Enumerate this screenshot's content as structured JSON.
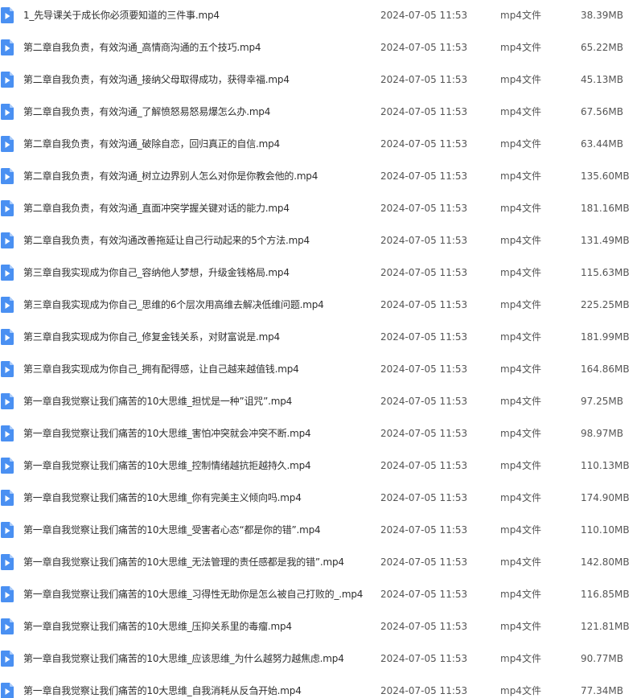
{
  "colors": {
    "icon_fill": "#4a90f2",
    "icon_fold": "#a9cbfa",
    "icon_glyph": "#ffffff",
    "text_primary": "#2e2e2e",
    "text_secondary": "#555555"
  },
  "icon": "video-file-icon",
  "files": [
    {
      "name": "1_先导课关于成长你必须要知道的三件事.mp4",
      "date": "2024-07-05 11:53",
      "type": "mp4文件",
      "size": "38.39MB"
    },
    {
      "name": "第二章自我负责，有效沟通_高情商沟通的五个技巧.mp4",
      "date": "2024-07-05 11:53",
      "type": "mp4文件",
      "size": "65.22MB"
    },
    {
      "name": "第二章自我负责，有效沟通_接纳父母取得成功，获得幸福.mp4",
      "date": "2024-07-05 11:53",
      "type": "mp4文件",
      "size": "45.13MB"
    },
    {
      "name": "第二章自我负责，有效沟通_了解愤怒易怒易爆怎么办.mp4",
      "date": "2024-07-05 11:53",
      "type": "mp4文件",
      "size": "67.56MB"
    },
    {
      "name": "第二章自我负责，有效沟通_破除自恋，回归真正的自信.mp4",
      "date": "2024-07-05 11:53",
      "type": "mp4文件",
      "size": "63.44MB"
    },
    {
      "name": "第二章自我负责，有效沟通_树立边界别人怎么对你是你教会他的.mp4",
      "date": "2024-07-05 11:53",
      "type": "mp4文件",
      "size": "135.60MB"
    },
    {
      "name": "第二章自我负责，有效沟通_直面冲突学握关键对话的能力.mp4",
      "date": "2024-07-05 11:53",
      "type": "mp4文件",
      "size": "181.16MB"
    },
    {
      "name": "第二章自我负责，有效沟通改善拖延让自己行动起来的5个方法.mp4",
      "date": "2024-07-05 11:53",
      "type": "mp4文件",
      "size": "131.49MB"
    },
    {
      "name": "第三章自我实现成为你自己_容纳他人梦想，升级金钱格局.mp4",
      "date": "2024-07-05 11:53",
      "type": "mp4文件",
      "size": "115.63MB"
    },
    {
      "name": "第三章自我实现成为你自己_思维的6个层次用高维去解决低维问题.mp4",
      "date": "2024-07-05 11:53",
      "type": "mp4文件",
      "size": "225.25MB"
    },
    {
      "name": "第三章自我实现成为你自己_修复金钱关系，对财富说是.mp4",
      "date": "2024-07-05 11:53",
      "type": "mp4文件",
      "size": "181.99MB"
    },
    {
      "name": "第三章自我实现成为你自己_拥有配得感，让自己越来越值钱.mp4",
      "date": "2024-07-05 11:53",
      "type": "mp4文件",
      "size": "164.86MB"
    },
    {
      "name": "第一章自我觉察让我们痛苦的10大思维_担忧是一种”诅咒”.mp4",
      "date": "2024-07-05 11:53",
      "type": "mp4文件",
      "size": "97.25MB"
    },
    {
      "name": "第一章自我觉察让我们痛苦的10大思维_害怕冲突就会冲突不断.mp4",
      "date": "2024-07-05 11:53",
      "type": "mp4文件",
      "size": "98.97MB"
    },
    {
      "name": "第一章自我觉察让我们痛苦的10大思维_控制情绪越抗拒越持久.mp4",
      "date": "2024-07-05 11:53",
      "type": "mp4文件",
      "size": "110.13MB"
    },
    {
      "name": "第一章自我觉察让我们痛苦的10大思维_你有完美主义倾向吗.mp4",
      "date": "2024-07-05 11:53",
      "type": "mp4文件",
      "size": "174.90MB"
    },
    {
      "name": "第一章自我觉察让我们痛苦的10大思维_受害者心态“都是你的错”.mp4",
      "date": "2024-07-05 11:53",
      "type": "mp4文件",
      "size": "110.10MB"
    },
    {
      "name": "第一章自我觉察让我们痛苦的10大思维_无法管理的责任感都是我的错”.mp4",
      "date": "2024-07-05 11:53",
      "type": "mp4文件",
      "size": "142.80MB"
    },
    {
      "name": "第一章自我觉察让我们痛苦的10大思维_习得性无助你是怎么被自己打败的_.mp4",
      "date": "2024-07-05 11:53",
      "type": "mp4文件",
      "size": "116.85MB"
    },
    {
      "name": "第一章自我觉察让我们痛苦的10大思维_压抑关系里的毒瘤.mp4",
      "date": "2024-07-05 11:53",
      "type": "mp4文件",
      "size": "121.81MB"
    },
    {
      "name": "第一章自我觉察让我们痛苦的10大思维_应该思维_为什么越努力越焦虑.mp4",
      "date": "2024-07-05 11:53",
      "type": "mp4文件",
      "size": "90.77MB"
    },
    {
      "name": "第一章自我觉察让我们痛苦的10大思维_自我消耗从反刍开始.mp4",
      "date": "2024-07-05 11:53",
      "type": "mp4文件",
      "size": "77.34MB"
    }
  ]
}
